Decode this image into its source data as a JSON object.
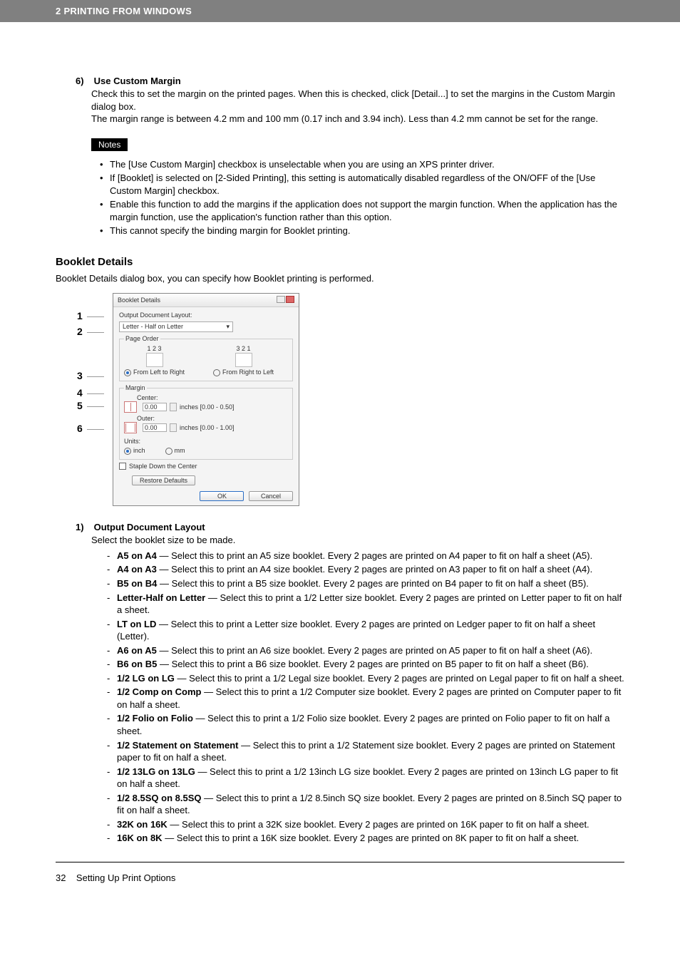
{
  "header": "2 PRINTING FROM WINDOWS",
  "item6": {
    "num": "6)",
    "title": "Use Custom Margin",
    "p1": "Check this to set the margin on the printed pages.  When this is checked, click [Detail...] to set the margins in the Custom Margin dialog box.",
    "p2": "The margin range is between 4.2 mm and 100 mm (0.17 inch and 3.94 inch). Less than 4.2 mm cannot be set for the range."
  },
  "notes_label": "Notes",
  "notes": [
    "The [Use Custom Margin] checkbox is unselectable when you are using an XPS printer driver.",
    "If [Booklet] is selected on [2-Sided Printing], this setting is automatically disabled regardless of the ON/OFF of the [Use Custom Margin] checkbox.",
    "Enable this function to add the margins if the application does not support the margin function.  When the application has the margin function, use the application's function rather than this option.",
    "This cannot specify the binding margin for Booklet printing."
  ],
  "section": {
    "title": "Booklet Details",
    "sub": "Booklet Details dialog box, you can specify how Booklet printing is performed."
  },
  "callouts": [
    "1",
    "2",
    "3",
    "4",
    "5",
    "6"
  ],
  "dialog": {
    "title": "Booklet Details",
    "output_label": "Output Document Layout:",
    "output_sel": "Letter - Half on Letter",
    "page_order_label": "Page Order",
    "ltr_num": "1 2 3",
    "rtl_num": "3 2 1",
    "ltr": "From Left to Right",
    "rtl": "From Right to Left",
    "margin_label": "Margin",
    "center_label": "Center:",
    "center_val": "0.00",
    "center_range": "inches [0.00 - 0.50]",
    "outer_label": "Outer:",
    "outer_val": "0.00",
    "outer_range": "inches [0.00 - 1.00]",
    "units_label": "Units:",
    "inch": "inch",
    "mm": "mm",
    "staple": "Staple Down the Center",
    "restore": "Restore Defaults",
    "ok": "OK",
    "cancel": "Cancel"
  },
  "item1": {
    "num": "1)",
    "title": "Output Document Layout",
    "sub": "Select the booklet size to be made."
  },
  "layouts": [
    {
      "name": "A5 on A4",
      "desc": " — Select this to print an A5 size booklet.  Every 2 pages are printed on A4 paper to fit on half a sheet (A5)."
    },
    {
      "name": "A4 on A3",
      "desc": " — Select this to print an A4 size booklet.  Every 2 pages are printed on A3 paper to fit on half a sheet (A4)."
    },
    {
      "name": "B5 on B4",
      "desc": " — Select this to print a B5 size booklet.  Every 2 pages are printed on B4 paper to fit on half a sheet (B5)."
    },
    {
      "name": "Letter-Half on Letter",
      "desc": " — Select this to print a 1/2 Letter size booklet.  Every 2 pages are printed on Letter paper to fit on half a sheet."
    },
    {
      "name": "LT on LD",
      "desc": " — Select this to print a Letter size booklet.  Every 2 pages are printed on Ledger paper to fit on half a sheet (Letter)."
    },
    {
      "name": "A6 on A5",
      "desc": " — Select this to print an A6 size booklet.  Every 2 pages are printed on A5 paper to fit on half a sheet (A6)."
    },
    {
      "name": "B6 on B5",
      "desc": " — Select this to print a B6 size booklet.  Every 2 pages are printed on B5 paper to fit on half a sheet (B6)."
    },
    {
      "name": "1/2 LG on LG",
      "desc": " — Select this to print a 1/2 Legal size booklet.  Every 2 pages are printed on Legal paper to fit on half a sheet."
    },
    {
      "name": "1/2 Comp on Comp",
      "desc": " — Select this to print a 1/2 Computer size booklet.  Every 2 pages are printed on Computer paper to fit on half a sheet."
    },
    {
      "name": "1/2 Folio on Folio",
      "desc": " — Select this to print a 1/2 Folio size booklet.  Every 2 pages are printed on Folio paper to fit on half a sheet."
    },
    {
      "name": "1/2 Statement on Statement",
      "desc": " — Select this to print a 1/2 Statement size booklet.  Every 2 pages are printed on Statement paper to fit on half a sheet."
    },
    {
      "name": "1/2 13LG on 13LG",
      "desc": " — Select this to print a 1/2 13inch LG size booklet.  Every 2 pages are printed on 13inch LG paper to fit on half a sheet."
    },
    {
      "name": "1/2 8.5SQ on 8.5SQ",
      "desc": " — Select this to print a 1/2 8.5inch SQ size booklet.  Every 2 pages are printed on 8.5inch SQ paper to fit on half a sheet."
    },
    {
      "name": "32K on 16K",
      "desc": " — Select this to print a 32K size booklet.  Every 2 pages are printed on 16K paper to fit on half a sheet."
    },
    {
      "name": "16K on 8K",
      "desc": " — Select this to print a 16K size booklet.  Every 2 pages are printed on 8K paper to fit on half a sheet."
    }
  ],
  "footer": {
    "page": "32",
    "title": "Setting Up Print Options"
  }
}
